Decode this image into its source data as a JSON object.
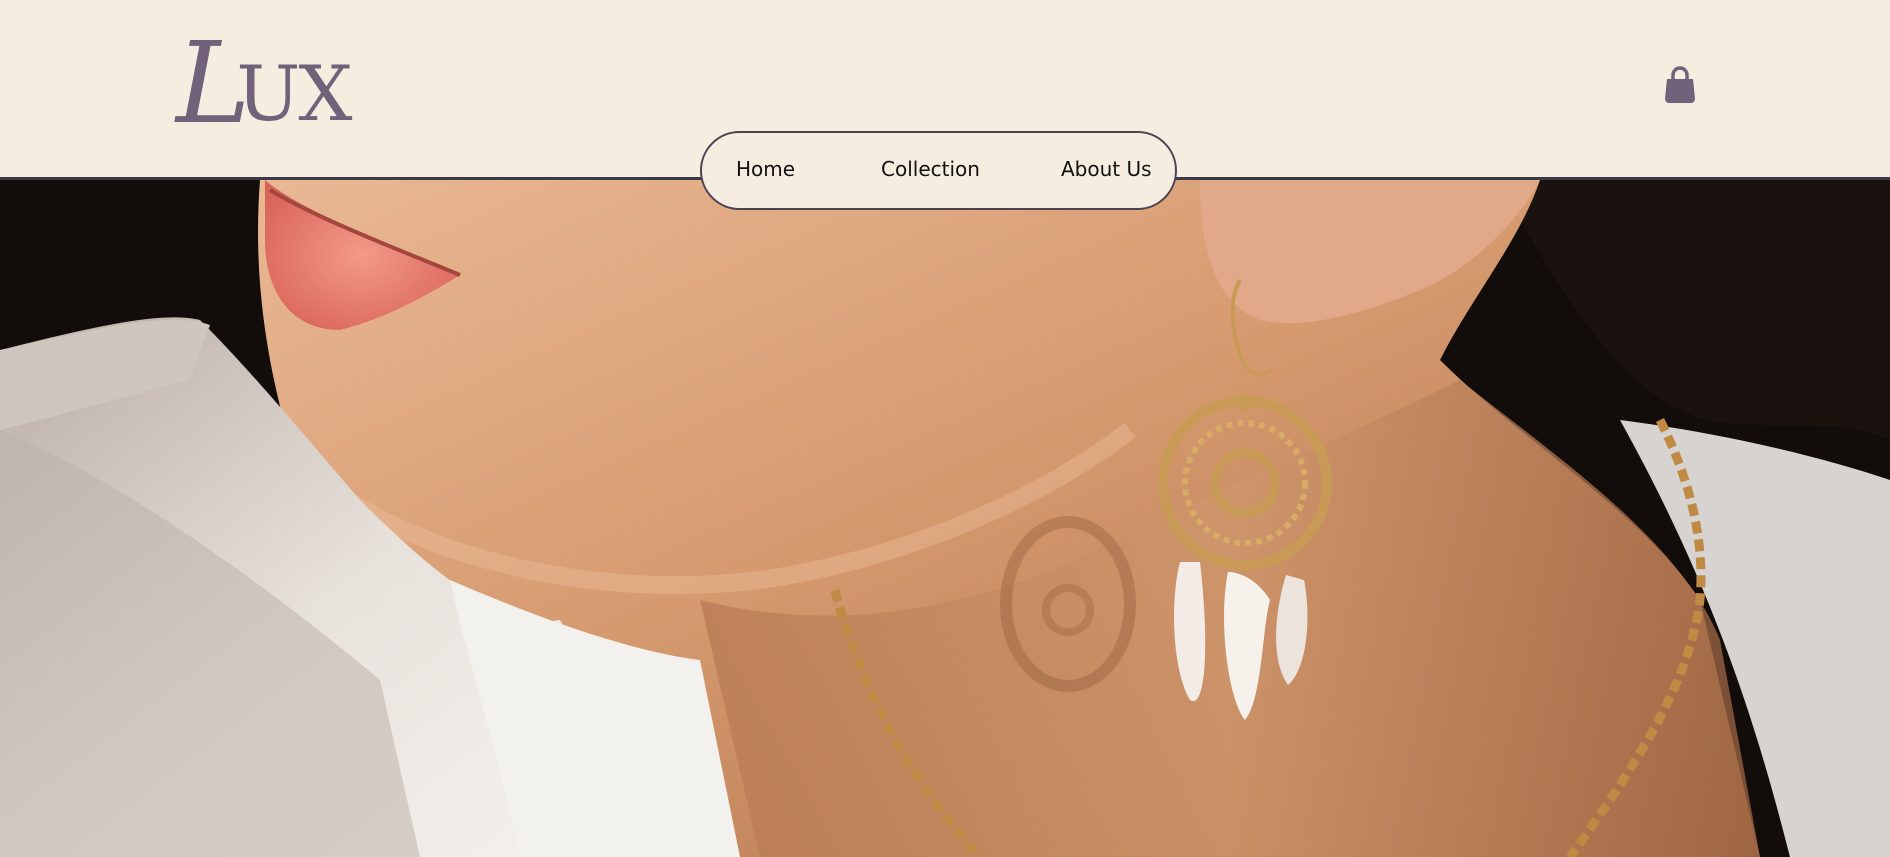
{
  "brand": {
    "logo_text": "LUX",
    "logo_l": "L",
    "logo_rest": "UX",
    "color": "#71617a"
  },
  "header": {
    "background": "#f5ede0",
    "rule_color": "#3d3a48"
  },
  "cart": {
    "icon": "shopping-bag-icon"
  },
  "nav": {
    "items": [
      {
        "label": "Home"
      },
      {
        "label": "Collection"
      },
      {
        "label": "About Us"
      }
    ],
    "border_color": "#4a4353"
  },
  "hero": {
    "image_subject": "close-up-portrait-gold-earring",
    "accent_gold": "#c99a55"
  }
}
